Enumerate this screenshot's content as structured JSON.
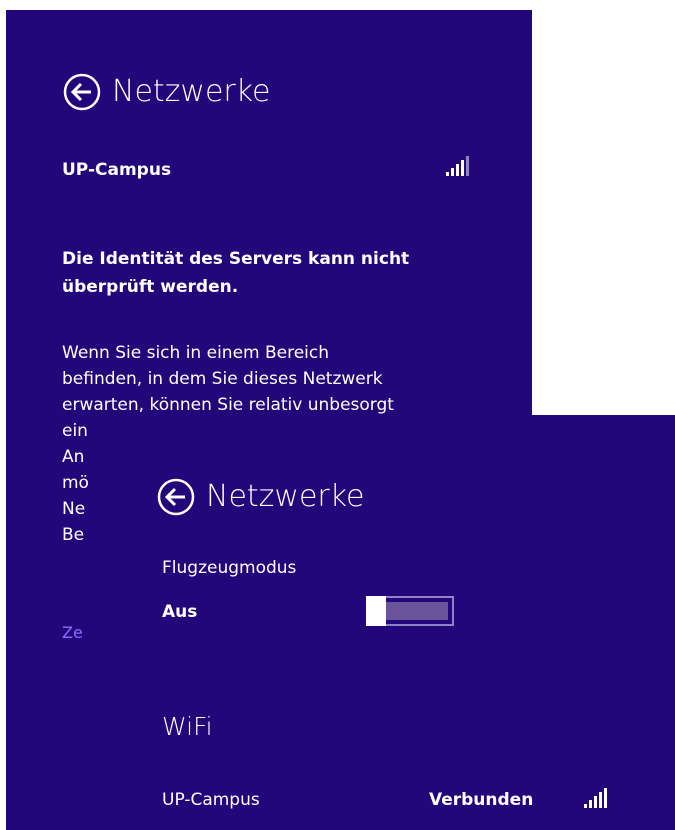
{
  "back_panel": {
    "title": "Netzwerke",
    "network_name": "UP-Campus",
    "warning_heading": "Die Identität des Servers kann nicht überprüft werden.",
    "body_visible_lines": [
      "Wenn Sie sich in einem Bereich",
      "befinden, in dem Sie dieses Netzwerk",
      "erwarten, können Sie relativ unbesorgt",
      "ein",
      "An",
      "mö",
      "Ne",
      "Be"
    ],
    "link_text": "Ze"
  },
  "front_panel": {
    "title": "Netzwerke",
    "airplane_mode_label": "Flugzeugmodus",
    "airplane_mode_state": "Aus",
    "airplane_mode_on": false,
    "wifi_heading": "WiFi",
    "network_name": "UP-Campus",
    "network_status": "Verbunden",
    "signal_bars": 5
  },
  "colors": {
    "panel_bg": "#22077a",
    "text": "#ffffff",
    "link": "#8e6bff"
  }
}
